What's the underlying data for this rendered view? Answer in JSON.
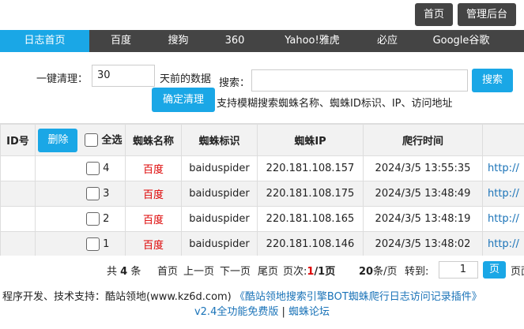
{
  "header": {
    "home_button": "首页",
    "admin_button": "管理后台"
  },
  "nav": {
    "items": [
      {
        "label": "日志首页",
        "active": true
      },
      {
        "label": "百度",
        "active": false
      },
      {
        "label": "搜狗",
        "active": false
      },
      {
        "label": "360",
        "active": false
      },
      {
        "label": "Yahoo!雅虎",
        "active": false
      },
      {
        "label": "必应",
        "active": false
      },
      {
        "label": "Google谷歌",
        "active": false
      }
    ]
  },
  "cleanup": {
    "label": "一键清理：",
    "days_value": "30",
    "suffix": "天前的数据",
    "confirm_button": "确定清理"
  },
  "search": {
    "label": "搜索：",
    "value": "",
    "button": "搜索",
    "hint": "支持模糊搜索蜘蛛名称、蜘蛛ID标识、IP、访问地址"
  },
  "table": {
    "headers": {
      "id": "ID号",
      "delete_button": "删除",
      "select_all": "全选",
      "spider_name": "蜘蛛名称",
      "spider_id": "蜘蛛标识",
      "spider_ip": "蜘蛛IP",
      "crawl_time": "爬行时间"
    },
    "rows": [
      {
        "id": "4",
        "name": "百度",
        "spider": "baiduspider",
        "ip": "220.181.108.157",
        "time": "2024/3/5 13:55:35",
        "url": "http://"
      },
      {
        "id": "3",
        "name": "百度",
        "spider": "baiduspider",
        "ip": "220.181.108.175",
        "time": "2024/3/5 13:48:49",
        "url": "http://"
      },
      {
        "id": "2",
        "name": "百度",
        "spider": "baiduspider",
        "ip": "220.181.108.165",
        "time": "2024/3/5 13:48:19",
        "url": "http://"
      },
      {
        "id": "1",
        "name": "百度",
        "spider": "baiduspider",
        "ip": "220.181.108.146",
        "time": "2024/3/5 13:48:02",
        "url": "http://"
      }
    ]
  },
  "pager": {
    "total_prefix": "共",
    "total_count": "4",
    "total_suffix": "条",
    "first": "首页",
    "prev": "上一页",
    "next": "下一页",
    "last": "尾页",
    "page_label": "页次:",
    "current_page": "1",
    "total_pages": "/1页",
    "per_page_count": "20",
    "per_page_suffix": "条/页",
    "goto_label": "转到:",
    "goto_value": "1",
    "goto_button": "页",
    "trailing": "页面"
  },
  "footer": {
    "credits": "程序开发、技术支持：酷站领地(www.kz6d.com)",
    "plugin_link": "《酷站领地搜索引擎BOT蜘蛛爬行日志访问记录插件》",
    "version_link": "v2.4全功能免费版",
    "separator": "|",
    "forum_link": "蜘蛛论坛"
  },
  "colors": {
    "accent": "#1aa7e6",
    "nav_bg": "#444444",
    "danger_text": "#dd0000",
    "link": "#1a73b8"
  }
}
